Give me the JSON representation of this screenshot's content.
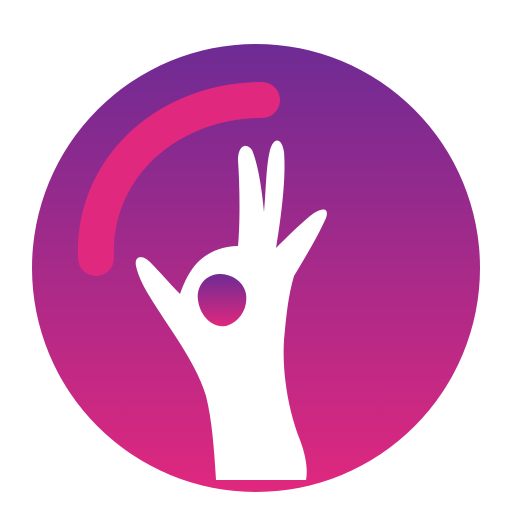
{
  "app_icon": {
    "name": "ok-hand-gesture-app-icon",
    "colors": {
      "background": "#ffffff",
      "circle_gradient_top": "#6e2b94",
      "circle_gradient_bottom": "#e0287e",
      "arc_accent": "#e0287e",
      "hand": "#ffffff"
    },
    "icons": [
      "ok-hand-icon",
      "progress-arc-icon"
    ]
  }
}
